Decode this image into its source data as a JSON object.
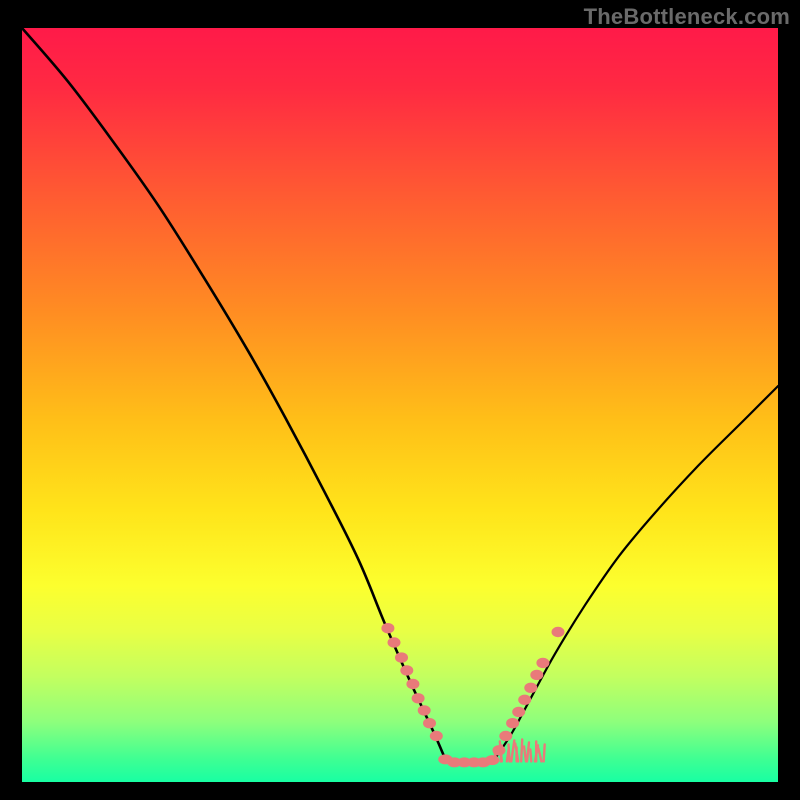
{
  "watermark": "TheBottleneck.com",
  "chart_data": {
    "type": "line",
    "title": "",
    "xlabel": "",
    "ylabel": "",
    "ylim": [
      0,
      100
    ],
    "curve_left": {
      "description": "Descending curve from top-left corner to valley floor near x≈0.56",
      "points_norm": [
        [
          0.0,
          0.0
        ],
        [
          0.06,
          0.07
        ],
        [
          0.12,
          0.15
        ],
        [
          0.18,
          0.235
        ],
        [
          0.24,
          0.33
        ],
        [
          0.3,
          0.43
        ],
        [
          0.35,
          0.52
        ],
        [
          0.4,
          0.615
        ],
        [
          0.445,
          0.705
        ],
        [
          0.48,
          0.79
        ],
        [
          0.515,
          0.87
        ],
        [
          0.545,
          0.935
        ],
        [
          0.56,
          0.97
        ]
      ]
    },
    "curve_right": {
      "description": "Ascending curve from valley floor near x≈0.63 to right edge at ≈45% height",
      "points_norm": [
        [
          0.625,
          0.97
        ],
        [
          0.648,
          0.935
        ],
        [
          0.675,
          0.885
        ],
        [
          0.705,
          0.83
        ],
        [
          0.745,
          0.765
        ],
        [
          0.79,
          0.7
        ],
        [
          0.84,
          0.64
        ],
        [
          0.895,
          0.58
        ],
        [
          0.95,
          0.525
        ],
        [
          1.0,
          0.475
        ]
      ]
    },
    "dot_clusters": {
      "color": "#e97a7a",
      "left_diag": [
        [
          0.484,
          0.796
        ],
        [
          0.492,
          0.815
        ],
        [
          0.502,
          0.835
        ],
        [
          0.509,
          0.852
        ],
        [
          0.517,
          0.87
        ],
        [
          0.524,
          0.889
        ],
        [
          0.532,
          0.905
        ],
        [
          0.539,
          0.922
        ],
        [
          0.548,
          0.939
        ]
      ],
      "right_diag": [
        [
          0.631,
          0.958
        ],
        [
          0.64,
          0.939
        ],
        [
          0.649,
          0.922
        ],
        [
          0.657,
          0.907
        ],
        [
          0.665,
          0.891
        ],
        [
          0.673,
          0.875
        ],
        [
          0.681,
          0.858
        ],
        [
          0.689,
          0.842
        ],
        [
          0.709,
          0.801
        ]
      ],
      "valley_floor": [
        [
          0.56,
          0.97
        ],
        [
          0.572,
          0.974
        ],
        [
          0.585,
          0.974
        ],
        [
          0.598,
          0.974
        ],
        [
          0.61,
          0.974
        ],
        [
          0.622,
          0.971
        ]
      ],
      "right_grass": {
        "x_range_norm": [
          0.628,
          0.69
        ],
        "y_norm": 0.97,
        "stroke_count": 16
      }
    }
  }
}
